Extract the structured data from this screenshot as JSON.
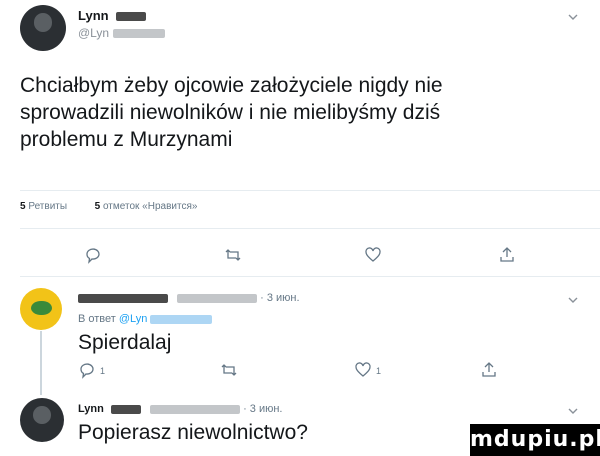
{
  "main_tweet": {
    "name": "Lynn",
    "handle": "@Lyn",
    "text_line1": "Chciałbym żeby ojcowie założyciele nigdy nie",
    "text_line2": "sprowadzili niewolników i nie mielibyśmy dziś",
    "text_line3": "problemu z Murzynami",
    "retweets_count": "5",
    "retweets_label": "Ретвиты",
    "likes_count": "5",
    "likes_label": "отметок «Нравится»"
  },
  "reply1": {
    "date": "· 3 июн.",
    "reply_prefix": "В ответ",
    "reply_handle": "@Lyn",
    "text": "Spierdalaj",
    "reply_count": "1",
    "like_count": "1"
  },
  "reply2": {
    "name": "Lynn",
    "date": "· 3 июн.",
    "text": "Popierasz niewolnictwo?"
  },
  "icons": [
    "reply-icon",
    "retweet-icon",
    "like-icon",
    "share-icon",
    "chevron-down-icon"
  ],
  "colors": {
    "text": "#14171a",
    "muted": "#657786",
    "link": "#1da1f2",
    "separator": "#e6ecf0"
  },
  "watermark": "mdupiu.pl"
}
